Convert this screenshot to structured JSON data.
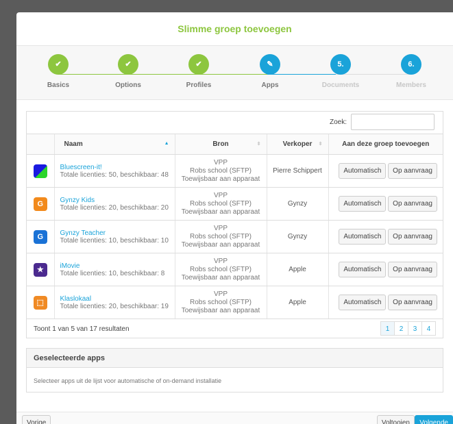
{
  "title": "Slimme groep toevoegen",
  "steps": [
    {
      "label": "Basics",
      "icon": "✔",
      "state": "done"
    },
    {
      "label": "Options",
      "icon": "✔",
      "state": "done"
    },
    {
      "label": "Profiles",
      "icon": "✔",
      "state": "done"
    },
    {
      "label": "Apps",
      "icon": "✎",
      "state": "active"
    },
    {
      "label": "Documents",
      "icon": "5.",
      "state": "todo"
    },
    {
      "label": "Members",
      "icon": "6.",
      "state": "todo"
    }
  ],
  "search": {
    "label": "Zoek:",
    "value": ""
  },
  "columns": {
    "naam": "Naam",
    "bron": "Bron",
    "verkoper": "Verkoper",
    "toevoegen": "Aan deze groep toevoegen"
  },
  "apps": [
    {
      "name": "Bluescreen-it!",
      "licenses": "Totale licenties: 50, beschikbaar: 48",
      "bron1": "VPP",
      "bron2": "Robs school (SFTP)",
      "bron3": "Toewijsbaar aan apparaat",
      "vendor": "Pierre Schippert",
      "icon": "bluescreen-icon"
    },
    {
      "name": "Gynzy Kids",
      "licenses": "Totale licenties: 20, beschikbaar: 20",
      "bron1": "VPP",
      "bron2": "Robs school (SFTP)",
      "bron3": "Toewijsbaar aan apparaat",
      "vendor": "Gynzy",
      "icon": "gynzy-kids-icon"
    },
    {
      "name": "Gynzy Teacher",
      "licenses": "Totale licenties: 10, beschikbaar: 10",
      "bron1": "VPP",
      "bron2": "Robs school (SFTP)",
      "bron3": "Toewijsbaar aan apparaat",
      "vendor": "Gynzy",
      "icon": "gynzy-teacher-icon"
    },
    {
      "name": "iMovie",
      "licenses": "Totale licenties: 10, beschikbaar: 8",
      "bron1": "VPP",
      "bron2": "Robs school (SFTP)",
      "bron3": "Toewijsbaar aan apparaat",
      "vendor": "Apple",
      "icon": "imovie-icon"
    },
    {
      "name": "Klaslokaal",
      "licenses": "Totale licenties: 20, beschikbaar: 19",
      "bron1": "VPP",
      "bron2": "Robs school (SFTP)",
      "bron3": "Toewijsbaar aan apparaat",
      "vendor": "Apple",
      "icon": "klaslokaal-icon"
    }
  ],
  "buttons": {
    "auto": "Automatisch",
    "ondemand": "Op aanvraag",
    "prev": "Vorige",
    "done": "Voltooien",
    "next": "Volgende"
  },
  "table_info": "Toont 1 van 5 van 17 resultaten",
  "pages": [
    "1",
    "2",
    "3",
    "4"
  ],
  "selected": {
    "title": "Geselecteerde apps",
    "hint": "Selecteer apps uit de lijst voor automatische of on-demand installatie"
  },
  "colors": {
    "green": "#8dc63f",
    "blue": "#1aa3d9"
  }
}
